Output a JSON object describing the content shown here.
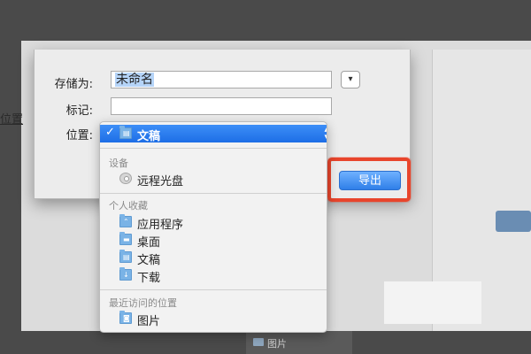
{
  "background": {
    "left_text": "位置",
    "bottom_label": "图片"
  },
  "dialog": {
    "save_as_label": "存储为:",
    "filename_value": "未命名",
    "tags_label": "标记:",
    "tags_value": "",
    "location_label": "位置:",
    "expand_icon": "▾",
    "export_button": "导出"
  },
  "location_menu": {
    "selected": {
      "label": "文稿",
      "check": "✓",
      "icon": "documents-folder-icon"
    },
    "sections": [
      {
        "title": "设备",
        "items": [
          {
            "label": "远程光盘",
            "icon": "remote-disc-icon"
          }
        ]
      },
      {
        "title": "个人收藏",
        "items": [
          {
            "label": "应用程序",
            "icon": "applications-folder-icon"
          },
          {
            "label": "桌面",
            "icon": "desktop-folder-icon"
          },
          {
            "label": "文稿",
            "icon": "documents-folder-icon"
          },
          {
            "label": "下载",
            "icon": "downloads-folder-icon"
          }
        ]
      },
      {
        "title": "最近访问的位置",
        "items": [
          {
            "label": "图片",
            "icon": "pictures-folder-icon"
          }
        ]
      }
    ]
  },
  "colors": {
    "accent": "#2f7fe8",
    "highlight_box": "#e8452c"
  }
}
